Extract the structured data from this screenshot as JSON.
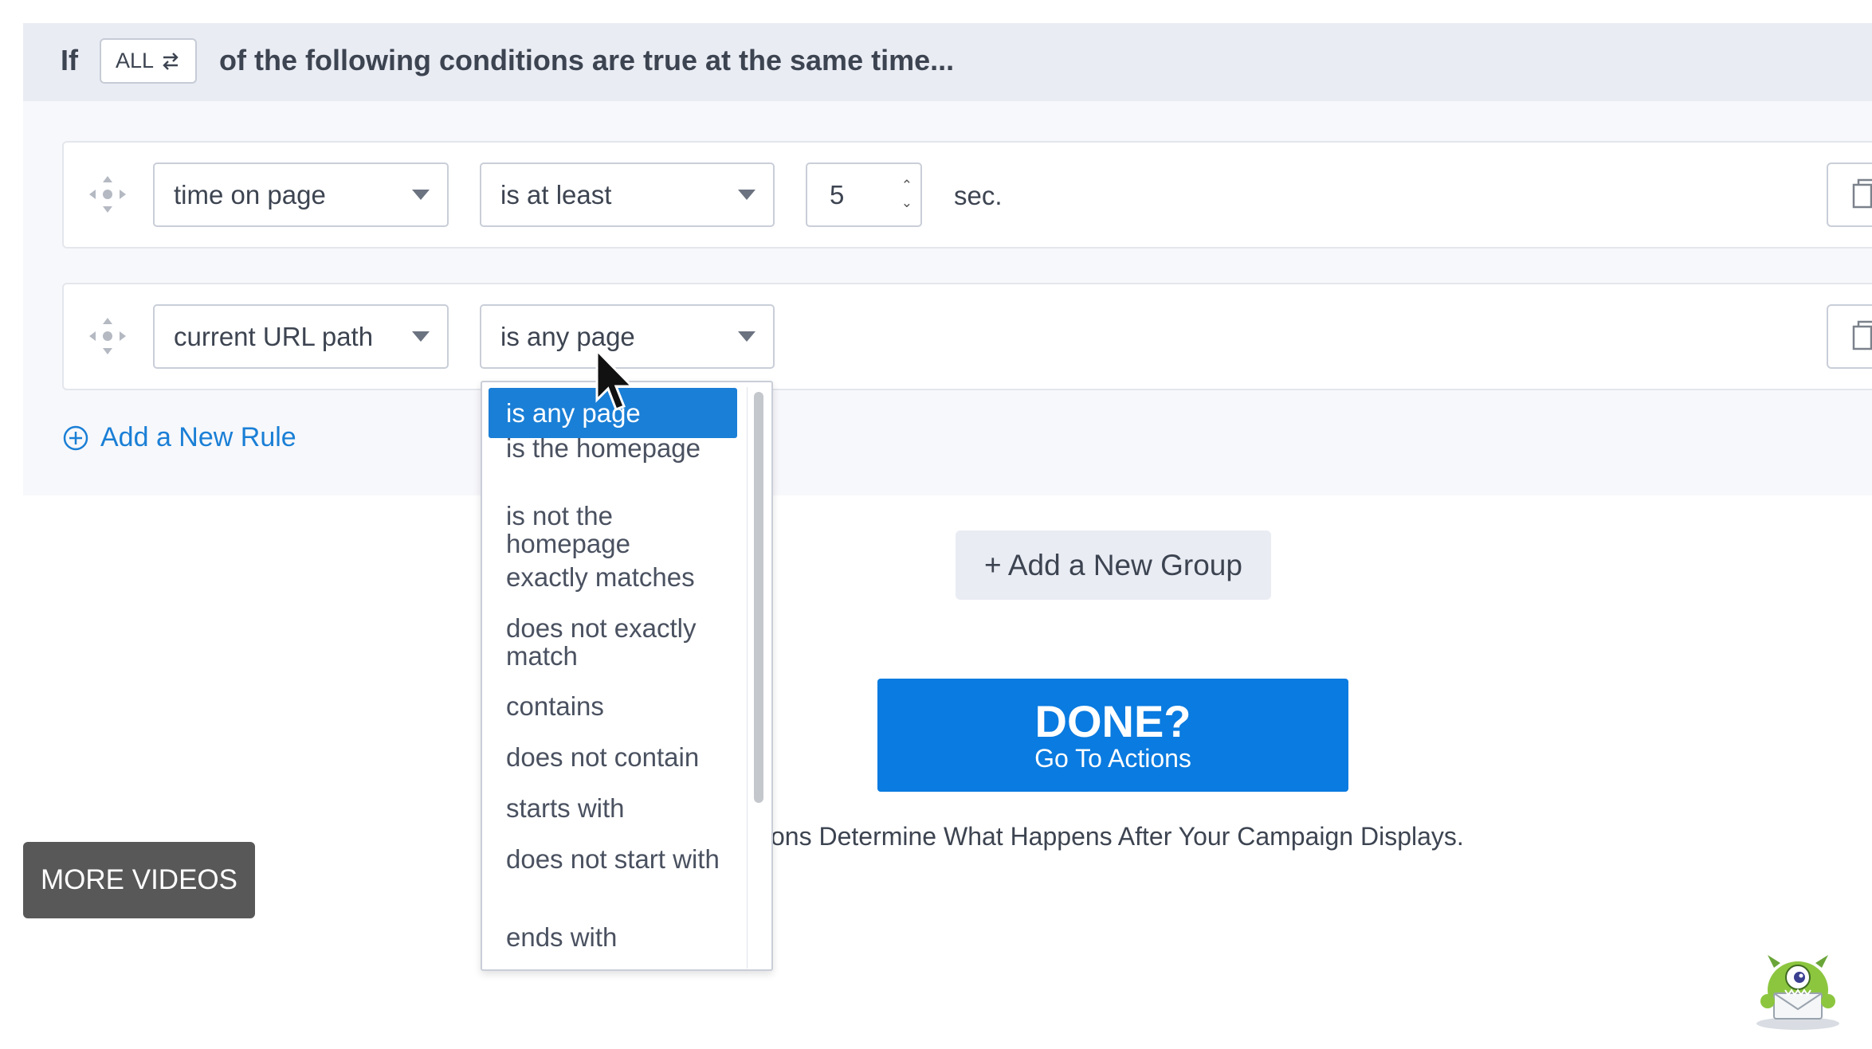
{
  "header": {
    "if_label": "If",
    "match_toggle": "ALL",
    "toggle_icon": "swap-arrows-icon",
    "condition_text": "of the following conditions are true at the same time..."
  },
  "rules": [
    {
      "field": "time on page",
      "operator": "is at least",
      "value": "5",
      "unit": "sec."
    },
    {
      "field": "current URL path",
      "operator": "is any page"
    }
  ],
  "add_rule_label": "Add a New Rule",
  "operator_dropdown": {
    "options": [
      "is any page",
      "is the homepage",
      "is not the homepage",
      "exactly matches",
      "does not exactly match",
      "contains",
      "does not contain",
      "starts with",
      "does not start with",
      "ends with"
    ],
    "selected": "is any page"
  },
  "add_group_label": "+ Add a New Group",
  "done_button": {
    "title": "DONE?",
    "subtitle": "Go To Actions"
  },
  "actions_hint": "ons Determine What Happens After Your Campaign Displays.",
  "more_videos_label": "MORE VIDEOS",
  "colors": {
    "accent": "#1a7fd6",
    "done_button": "#0a7be0",
    "header_bg": "#e9ecf3",
    "more_videos_bg": "#585858"
  }
}
